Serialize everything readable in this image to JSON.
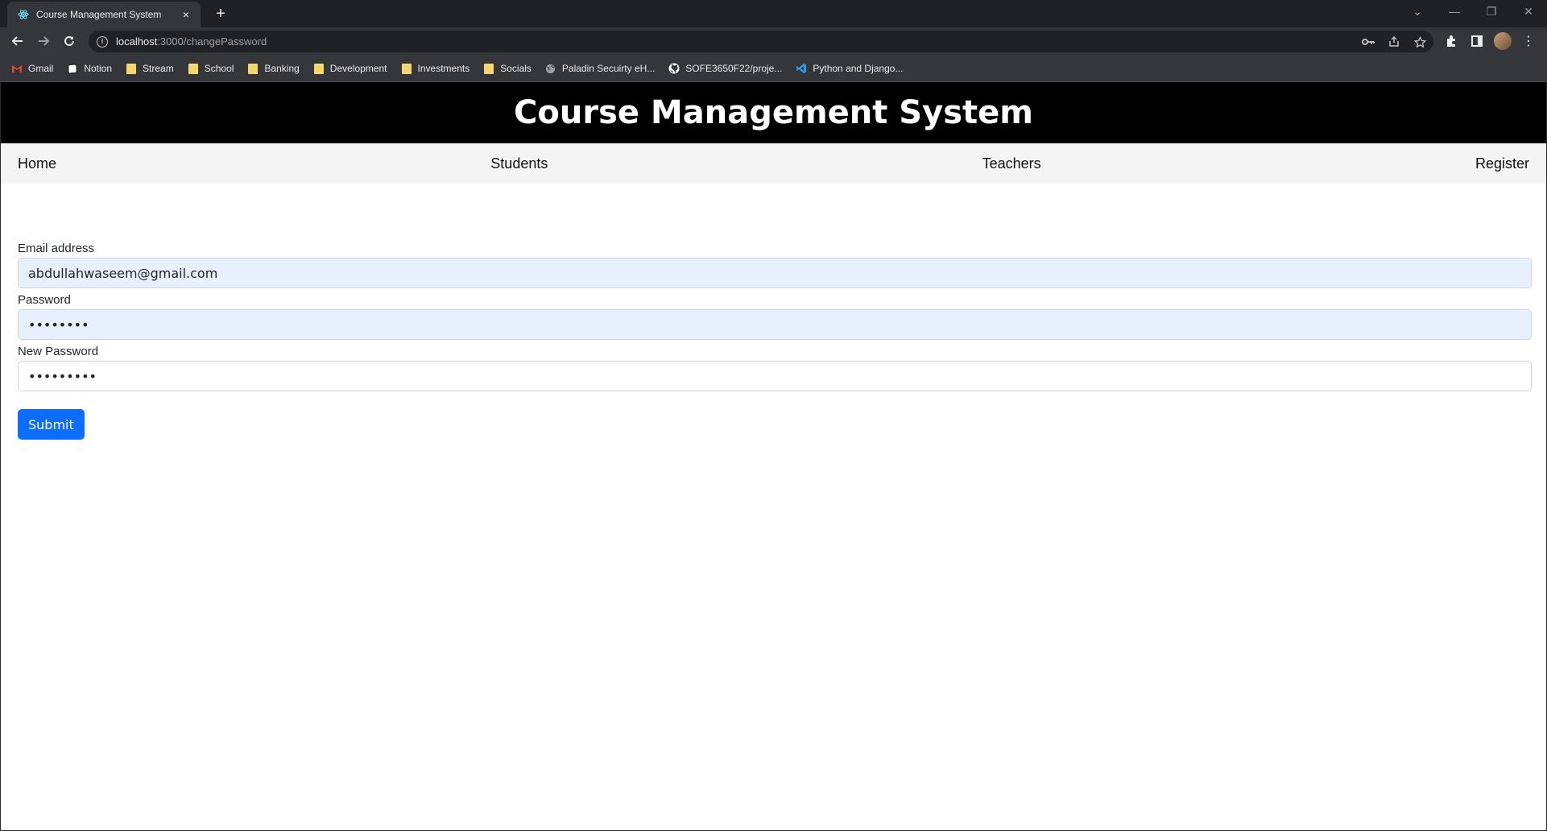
{
  "browser": {
    "tab_title": "Course Management System",
    "tab_close": "×",
    "new_tab": "+",
    "url_host": "localhost",
    "url_path": ":3000/changePassword",
    "bookmarks": [
      {
        "label": "Gmail",
        "icon": "gmail-icon"
      },
      {
        "label": "Notion",
        "icon": "notion-icon"
      },
      {
        "label": "Stream",
        "icon": "folder-icon"
      },
      {
        "label": "School",
        "icon": "folder-icon"
      },
      {
        "label": "Banking",
        "icon": "folder-icon"
      },
      {
        "label": "Development",
        "icon": "folder-icon"
      },
      {
        "label": "Investments",
        "icon": "folder-icon"
      },
      {
        "label": "Socials",
        "icon": "folder-icon"
      },
      {
        "label": "Paladin Secuirty eH...",
        "icon": "globe-icon"
      },
      {
        "label": "SOFE3650F22/proje...",
        "icon": "github-icon"
      },
      {
        "label": "Python and Django...",
        "icon": "vscode-icon"
      }
    ]
  },
  "app": {
    "title": "Course Management System",
    "nav": {
      "home": "Home",
      "students": "Students",
      "teachers": "Teachers",
      "register": "Register"
    }
  },
  "form": {
    "email_label": "Email address",
    "email_value": "abdullahwaseem@gmail.com",
    "password_label": "Password",
    "password_value": "••••••••",
    "new_password_label": "New Password",
    "new_password_value": "•••••••••",
    "submit_label": "Submit"
  },
  "colors": {
    "header_bg": "#000000",
    "nav_bg": "#f4f4f4",
    "autofill_bg": "#e8f0fe",
    "primary_button": "#0d6efd"
  }
}
